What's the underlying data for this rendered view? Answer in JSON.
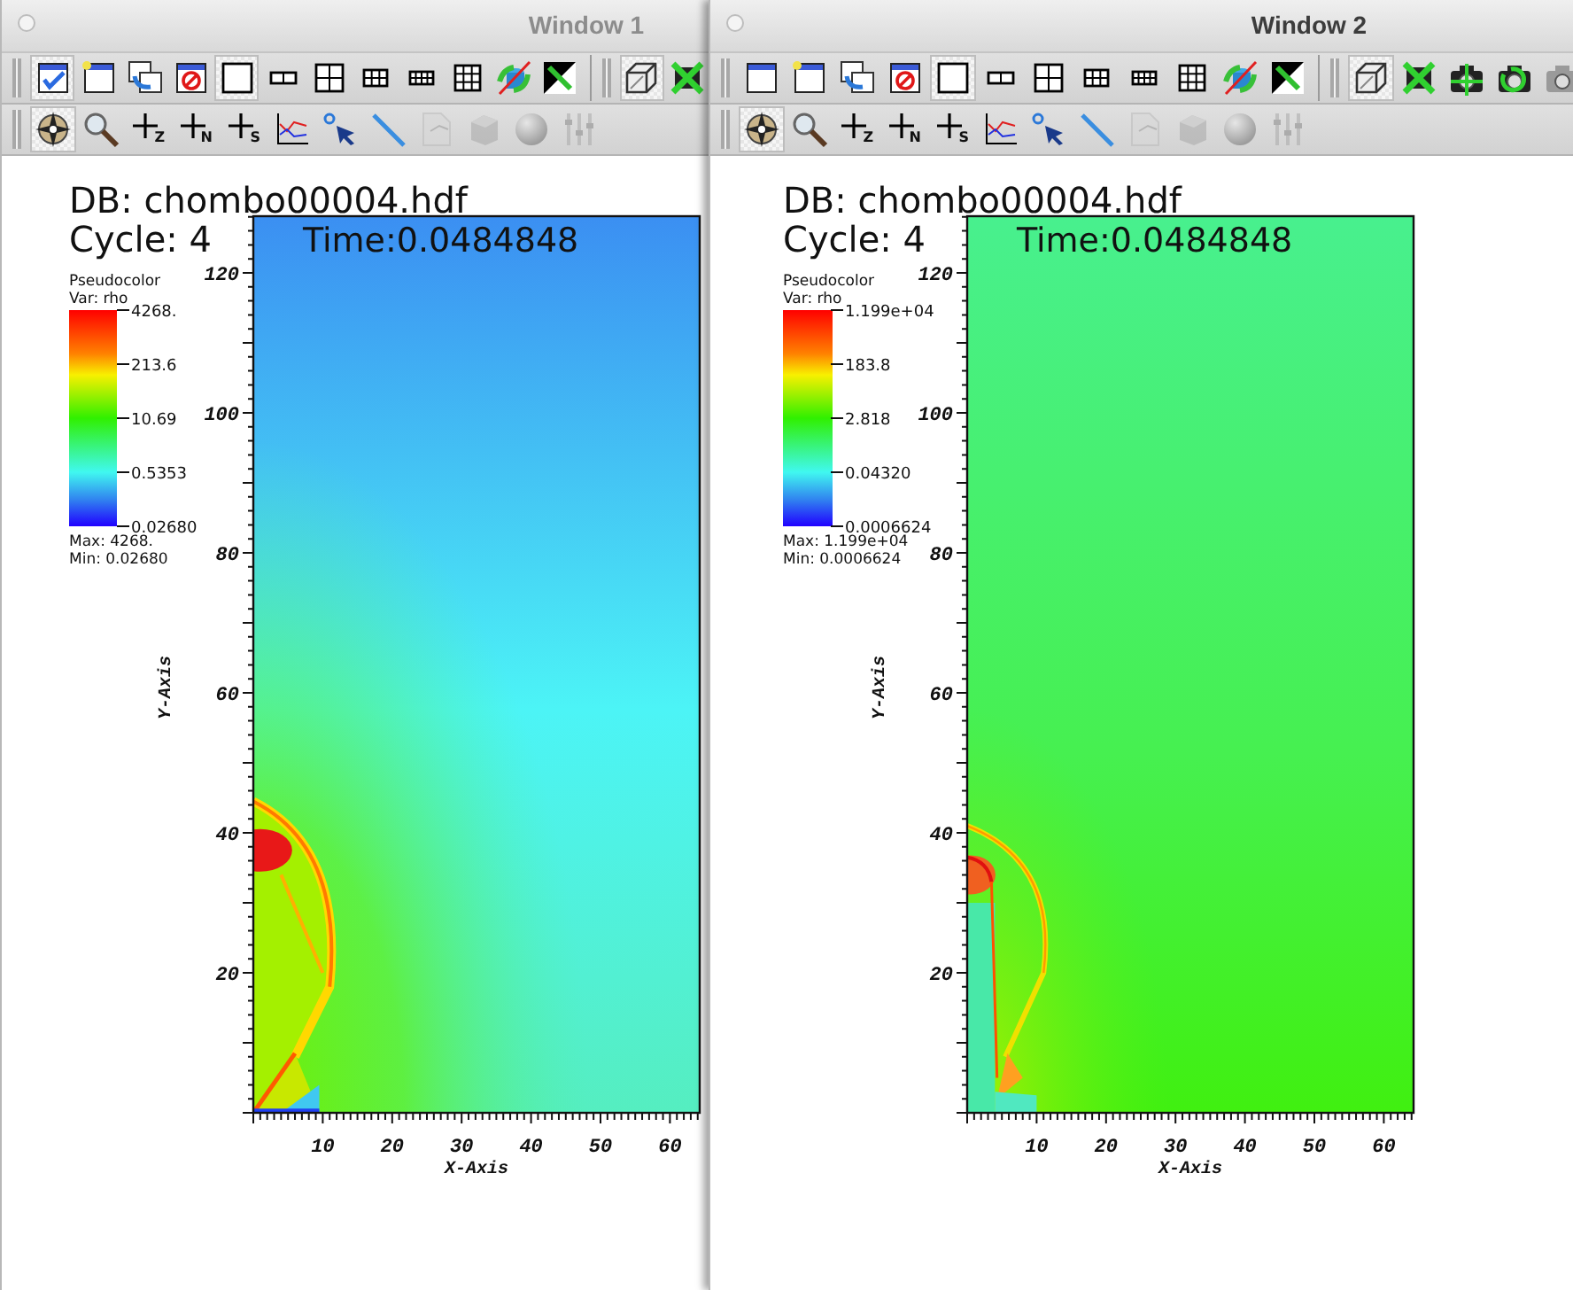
{
  "windows": [
    {
      "title": "Window 1",
      "active": false,
      "toolbar_main": [
        {
          "buttons": [
            {
              "kind": "window-check",
              "selected": true
            },
            {
              "kind": "new-window",
              "selected": false
            },
            {
              "kind": "clone-window",
              "selected": false
            },
            {
              "kind": "delete-window",
              "selected": false
            },
            {
              "kind": "layout-1x1",
              "selected": true
            },
            {
              "kind": "layout-2x1",
              "selected": false
            },
            {
              "kind": "layout-2x2",
              "selected": false
            },
            {
              "kind": "layout-3x2",
              "selected": false
            },
            {
              "kind": "layout-4x2",
              "selected": false
            },
            {
              "kind": "layout-3x3",
              "selected": false
            },
            {
              "kind": "spin",
              "selected": false
            },
            {
              "kind": "full-frame",
              "selected": false
            }
          ]
        },
        {
          "buttons": [
            {
              "kind": "perspective",
              "selected": true
            },
            {
              "kind": "lock-view",
              "selected": false
            }
          ]
        }
      ],
      "toolbar_view": [
        {
          "kind": "navigate",
          "selected": true,
          "disabled": false
        },
        {
          "kind": "zoom",
          "selected": false,
          "disabled": false
        },
        {
          "kind": "pick",
          "label": "Z",
          "selected": false,
          "disabled": false
        },
        {
          "kind": "pick",
          "label": "N",
          "selected": false,
          "disabled": false
        },
        {
          "kind": "pick",
          "label": "S",
          "selected": false,
          "disabled": false
        },
        {
          "kind": "lineout",
          "selected": false,
          "disabled": false
        },
        {
          "kind": "point",
          "selected": false,
          "disabled": false
        },
        {
          "kind": "line",
          "selected": false,
          "disabled": false
        },
        {
          "kind": "page",
          "selected": false,
          "disabled": true
        },
        {
          "kind": "cube",
          "selected": false,
          "disabled": true
        },
        {
          "kind": "sphere",
          "selected": false,
          "disabled": true
        },
        {
          "kind": "sliders",
          "selected": false,
          "disabled": true
        }
      ],
      "plot": {
        "db": "DB: chombo00004.hdf",
        "cycle": "Cycle: 4",
        "time": "Time:0.0484848",
        "legend_title": "Pseudocolor",
        "legend_var": "Var: rho",
        "legend_ticks": [
          "4268.",
          "213.6",
          "10.69",
          "0.5353",
          "0.02680"
        ],
        "max": "Max: 4268.",
        "min": "Min: 0.02680",
        "xticks": [
          "10",
          "20",
          "30",
          "40",
          "50",
          "60"
        ],
        "yticks": [
          "120",
          "100",
          "80",
          "60",
          "40",
          "20"
        ],
        "xlabel": "X-Axis",
        "ylabel": "Y-Axis"
      }
    },
    {
      "title": "Window 2",
      "active": true,
      "toolbar_main": [
        {
          "buttons": [
            {
              "kind": "window",
              "selected": false
            },
            {
              "kind": "new-window",
              "selected": false
            },
            {
              "kind": "clone-window",
              "selected": false
            },
            {
              "kind": "delete-window",
              "selected": false
            },
            {
              "kind": "layout-1x1",
              "selected": true
            },
            {
              "kind": "layout-2x1",
              "selected": false
            },
            {
              "kind": "layout-2x2",
              "selected": false
            },
            {
              "kind": "layout-3x2",
              "selected": false
            },
            {
              "kind": "layout-4x2",
              "selected": false
            },
            {
              "kind": "layout-3x3",
              "selected": false
            },
            {
              "kind": "spin",
              "selected": false
            },
            {
              "kind": "full-frame",
              "selected": false
            }
          ]
        },
        {
          "buttons": [
            {
              "kind": "perspective",
              "selected": true
            },
            {
              "kind": "lock-view",
              "selected": false
            },
            {
              "kind": "camera-move",
              "selected": false
            },
            {
              "kind": "camera-rotate",
              "selected": false
            },
            {
              "kind": "camera",
              "selected": false
            }
          ]
        }
      ],
      "toolbar_view": [
        {
          "kind": "navigate",
          "selected": true,
          "disabled": false
        },
        {
          "kind": "zoom",
          "selected": false,
          "disabled": false
        },
        {
          "kind": "pick",
          "label": "Z",
          "selected": false,
          "disabled": false
        },
        {
          "kind": "pick",
          "label": "N",
          "selected": false,
          "disabled": false
        },
        {
          "kind": "pick",
          "label": "S",
          "selected": false,
          "disabled": false
        },
        {
          "kind": "lineout",
          "selected": false,
          "disabled": false
        },
        {
          "kind": "point",
          "selected": false,
          "disabled": false
        },
        {
          "kind": "line",
          "selected": false,
          "disabled": false
        },
        {
          "kind": "page",
          "selected": false,
          "disabled": true
        },
        {
          "kind": "cube",
          "selected": false,
          "disabled": true
        },
        {
          "kind": "sphere",
          "selected": false,
          "disabled": true
        },
        {
          "kind": "sliders",
          "selected": false,
          "disabled": true
        }
      ],
      "plot": {
        "db": "DB: chombo00004.hdf",
        "cycle": "Cycle: 4",
        "time": "Time:0.0484848",
        "legend_title": "Pseudocolor",
        "legend_var": "Var: rho",
        "legend_ticks": [
          "1.199e+04",
          "183.8",
          "2.818",
          "0.04320",
          "0.0006624"
        ],
        "max": "Max: 1.199e+04",
        "min": "Min: 0.0006624",
        "xticks": [
          "10",
          "20",
          "30",
          "40",
          "50",
          "60"
        ],
        "yticks": [
          "120",
          "100",
          "80",
          "60",
          "40",
          "20"
        ],
        "xlabel": "X-Axis",
        "ylabel": "Y-Axis"
      }
    }
  ]
}
